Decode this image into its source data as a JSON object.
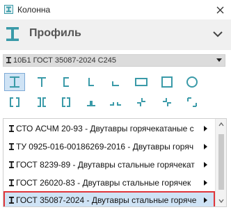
{
  "window": {
    "title": "Колонна",
    "icon": "column-app-icon"
  },
  "header": {
    "label": "Профиль",
    "icon": "i-beam-icon",
    "collapse_icon": "chevron-down-icon"
  },
  "profile_select": {
    "value": "10Б1 ГОСТ 35087-2024 С245"
  },
  "shapes": [
    {
      "icon": "i-beam-shape-icon",
      "selected": true
    },
    {
      "icon": "t-shape-icon",
      "selected": false
    },
    {
      "icon": "channel-shape-icon",
      "selected": false
    },
    {
      "icon": "angle-shape-icon",
      "selected": false
    },
    {
      "icon": "unequal-angle-shape-icon",
      "selected": false
    },
    {
      "icon": "rect-tube-shape-icon",
      "selected": false
    },
    {
      "icon": "square-tube-shape-icon",
      "selected": false
    },
    {
      "icon": "round-tube-shape-icon",
      "selected": false
    },
    {
      "icon": "double-channel-box-icon",
      "selected": false
    },
    {
      "icon": "double-channel-back-icon",
      "selected": false
    },
    {
      "icon": "double-channel-face-icon",
      "selected": false
    },
    {
      "icon": "double-angle-tee-icon",
      "selected": false
    },
    {
      "icon": "double-angle-apart-icon",
      "selected": false
    },
    {
      "icon": "cross-angle-icon",
      "selected": false
    },
    {
      "icon": "star-angle-icon",
      "selected": false
    },
    {
      "icon": "box-angle-icon",
      "selected": false
    }
  ],
  "standards": [
    {
      "label": "СТО АСЧМ 20-93 - Двутавры горячекатаные с",
      "selected": false
    },
    {
      "label": "ТУ 0925-016-00186269-2016 - Двутавры горяч",
      "selected": false
    },
    {
      "label": "ГОСТ 8239-89 - Двутавры стальные горячекат",
      "selected": false
    },
    {
      "label": "ГОСТ 26020-83 - Двутавры стальные горячек",
      "selected": false
    },
    {
      "label": "ГОСТ 35087-2024 - Двутавры стальные горячe",
      "selected": true
    }
  ],
  "colors": {
    "accent": "#3a9aa8",
    "selection_bg": "#cfe3f5",
    "selection_border": "#e0353a"
  }
}
